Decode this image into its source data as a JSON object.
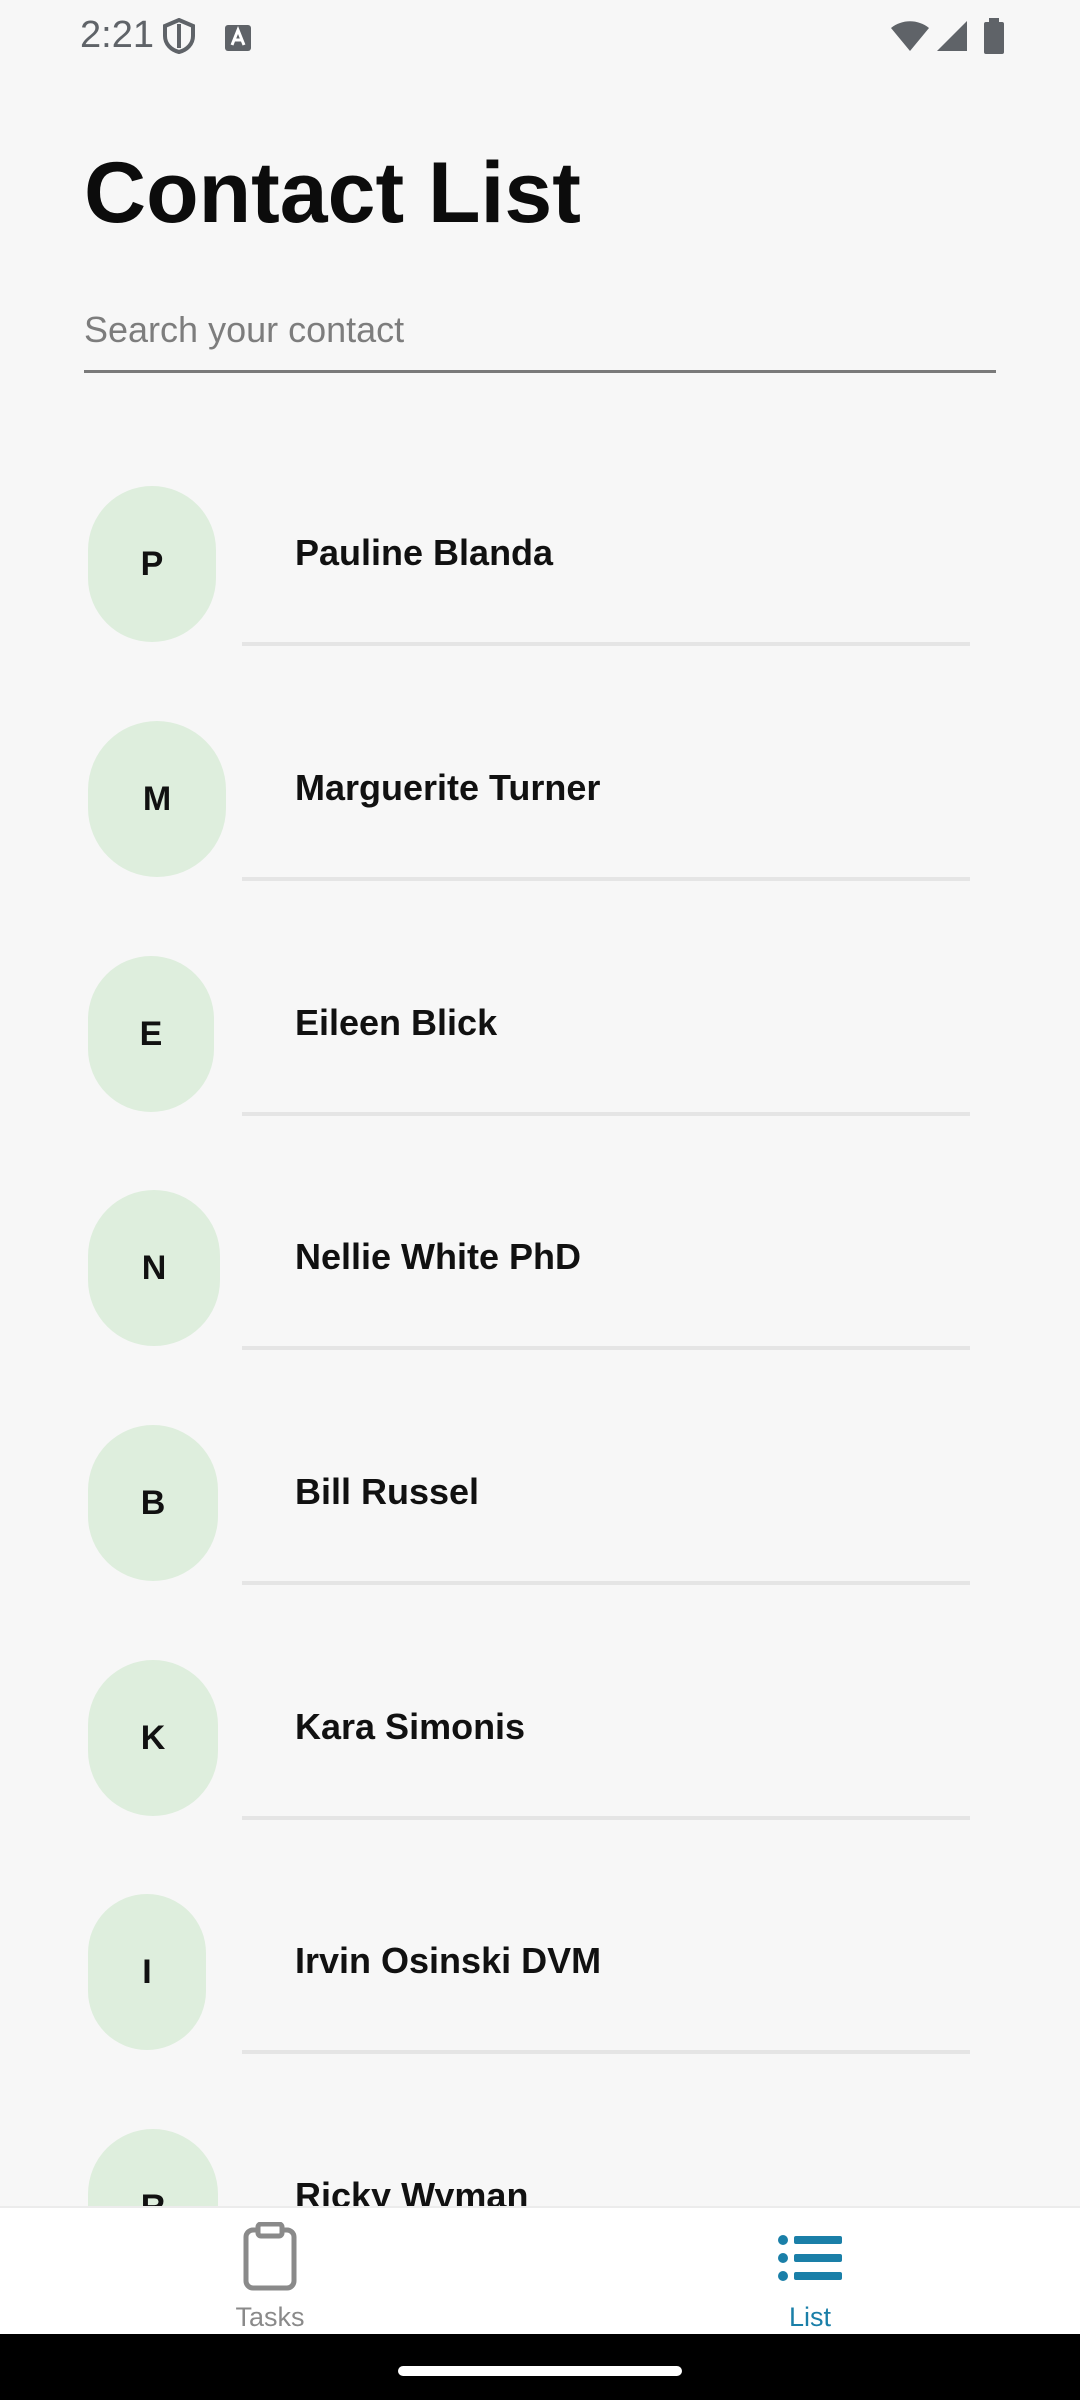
{
  "status_bar": {
    "time": "2:21"
  },
  "page": {
    "title": "Contact List"
  },
  "search": {
    "placeholder": "Search your contact",
    "value": ""
  },
  "contacts": [
    {
      "initial": "P",
      "name": "Pauline Blanda"
    },
    {
      "initial": "M",
      "name": "Marguerite Turner"
    },
    {
      "initial": "E",
      "name": "Eileen Blick"
    },
    {
      "initial": "N",
      "name": "Nellie White PhD"
    },
    {
      "initial": "B",
      "name": "Bill Russel"
    },
    {
      "initial": "K",
      "name": "Kara Simonis"
    },
    {
      "initial": "I",
      "name": "Irvin Osinski DVM"
    },
    {
      "initial": "R",
      "name": "Ricky Wyman"
    }
  ],
  "bottom_nav": {
    "items": [
      {
        "label": "Tasks",
        "icon": "clipboard-icon",
        "active": false
      },
      {
        "label": "List",
        "icon": "list-icon",
        "active": true
      }
    ]
  },
  "colors": {
    "background": "#f7f7f7",
    "avatar_bg": "#deeedd",
    "accent": "#1a7fa8",
    "inactive": "#8a8a8a"
  }
}
